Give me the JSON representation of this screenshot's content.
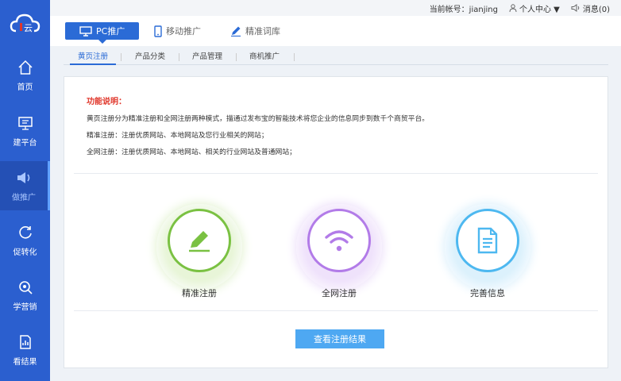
{
  "topbar": {
    "account_label": "当前帐号：jianjing",
    "user_center": "个人中心 ▼",
    "messages": "消息(0)"
  },
  "sidebar": {
    "logo_text": "云",
    "items": [
      {
        "label": "首页",
        "icon": "home-icon"
      },
      {
        "label": "建平台",
        "icon": "monitor-icon"
      },
      {
        "label": "做推广",
        "icon": "speaker-icon"
      },
      {
        "label": "促转化",
        "icon": "refresh-icon"
      },
      {
        "label": "学营销",
        "icon": "search-icon"
      },
      {
        "label": "看结果",
        "icon": "report-icon"
      }
    ],
    "active_index": 2
  },
  "tabs": [
    {
      "label": "PC推广",
      "icon": "desktop-icon"
    },
    {
      "label": "移动推广",
      "icon": "mobile-icon"
    },
    {
      "label": "精准词库",
      "icon": "pencil-icon"
    }
  ],
  "subtabs": [
    "黄页注册",
    "产品分类",
    "产品管理",
    "商机推广"
  ],
  "description": {
    "title": "功能说明：",
    "lines": [
      "黄页注册分为精准注册和全网注册两种模式，描通过发布宝的智能技术将您企业的信息同步到数千个商贸平台。",
      "精准注册：注册优质网站、本地网站及您行业相关的网站；",
      "全网注册：注册优质网站、本地网站、相关的行业网站及普通网站；"
    ]
  },
  "options": [
    {
      "label": "精准注册",
      "icon": "pencil-icon",
      "color": "#7ac142"
    },
    {
      "label": "全网注册",
      "icon": "wifi-icon",
      "color": "#b27be8"
    },
    {
      "label": "完善信息",
      "icon": "document-icon",
      "color": "#4db8f0"
    }
  ],
  "button": {
    "label": "查看注册结果"
  },
  "colors": {
    "sidebar": "#2b5fcf",
    "accent": "#2b6bd6",
    "button": "#4ea8f2",
    "warning": "#e0362a"
  }
}
